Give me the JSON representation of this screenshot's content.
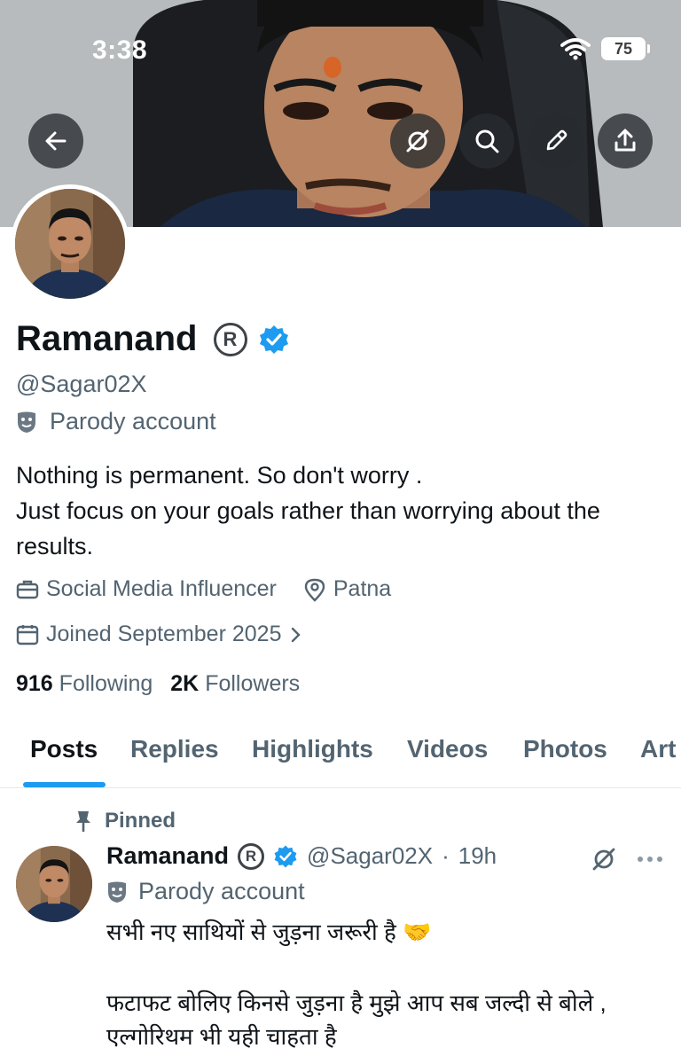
{
  "status_bar": {
    "time": "3:38",
    "battery": "75"
  },
  "profile": {
    "display_name": "Ramanand",
    "handle": "@Sagar02X",
    "parody_label": "Parody account",
    "bio_line_1": "Nothing is permanent. So don't worry .",
    "bio_line_2": "Just focus on your goals rather than worrying about the results.",
    "category": "Social Media Influencer",
    "location": "Patna",
    "joined": "Joined September 2025",
    "following_count": "916",
    "following_label": "Following",
    "followers_count": "2K",
    "followers_label": "Followers",
    "verified_color": "#1d9bf0"
  },
  "tabs": [
    {
      "label": "Posts"
    },
    {
      "label": "Replies"
    },
    {
      "label": "Highlights"
    },
    {
      "label": "Videos"
    },
    {
      "label": "Photos"
    },
    {
      "label": "Art"
    }
  ],
  "header_icons": [
    "back-arrow-icon",
    "grok-icon",
    "search-icon",
    "edit-pencil-icon",
    "share-icon"
  ],
  "post": {
    "pinned_label": "Pinned",
    "author_name": "Ramanand",
    "author_handle": "@Sagar02X",
    "separator": "·",
    "time": "19h",
    "parody_label": "Parody account",
    "text_line_1": "सभी नए साथियों से जुड़ना जरूरी है 🤝",
    "text_line_2": "फटाफट बोलिए किनसे जुड़ना है मुझे आप सब जल्दी से बोले ,",
    "text_line_3": "एल्गोरिथम भी यही चाहता है"
  }
}
